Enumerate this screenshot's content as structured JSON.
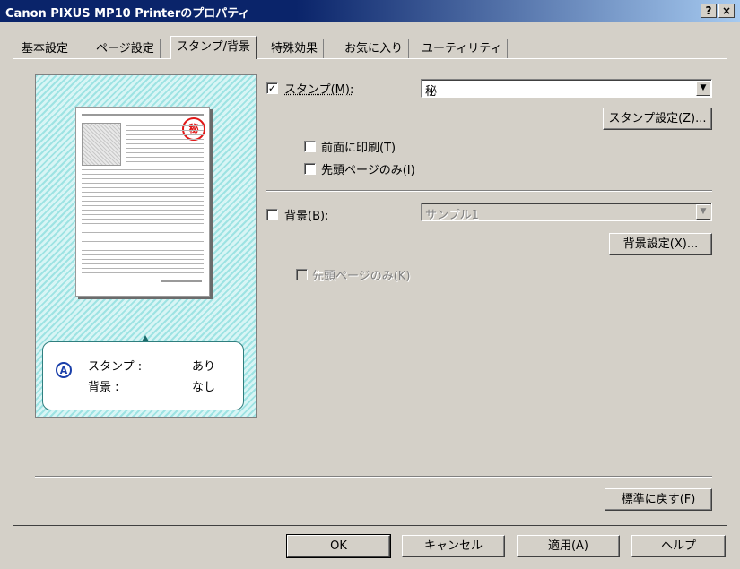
{
  "window": {
    "title": "Canon PIXUS MP10 Printerのプロパティ",
    "help_button": "?",
    "close_button": "×"
  },
  "tabs": [
    {
      "label": "基本設定",
      "active": false
    },
    {
      "label": "ページ設定",
      "active": false
    },
    {
      "label": "スタンプ/背景",
      "active": true
    },
    {
      "label": "特殊効果",
      "active": false
    },
    {
      "label": "お気に入り",
      "active": false
    },
    {
      "label": "ユーティリティ",
      "active": false
    }
  ],
  "preview": {
    "stamp_glyph": "秘",
    "badge": "A",
    "stamp_label": "スタンプ :",
    "stamp_value": "あり",
    "background_label": "背景 :",
    "background_value": "なし"
  },
  "stamp": {
    "checkbox_label": "スタンプ(M):",
    "checked": true,
    "selected_value": "秘",
    "settings_button": "スタンプ設定(Z)...",
    "print_front_label": "前面に印刷(T)",
    "print_front_checked": false,
    "first_page_label": "先頭ページのみ(I)",
    "first_page_checked": false
  },
  "background": {
    "checkbox_label": "背景(B):",
    "checked": false,
    "selected_value": "サンプル1",
    "settings_button": "背景設定(X)...",
    "first_page_label": "先頭ページのみ(K)",
    "first_page_checked": false
  },
  "restore_button": "標準に戻す(F)",
  "footer": {
    "ok": "OK",
    "cancel": "キャンセル",
    "apply": "適用(A)",
    "help": "ヘルプ"
  },
  "colors": {
    "titlebar": "#0a246a",
    "stamp_red": "#e01818",
    "preview_hatch": "#9ee3e3"
  }
}
